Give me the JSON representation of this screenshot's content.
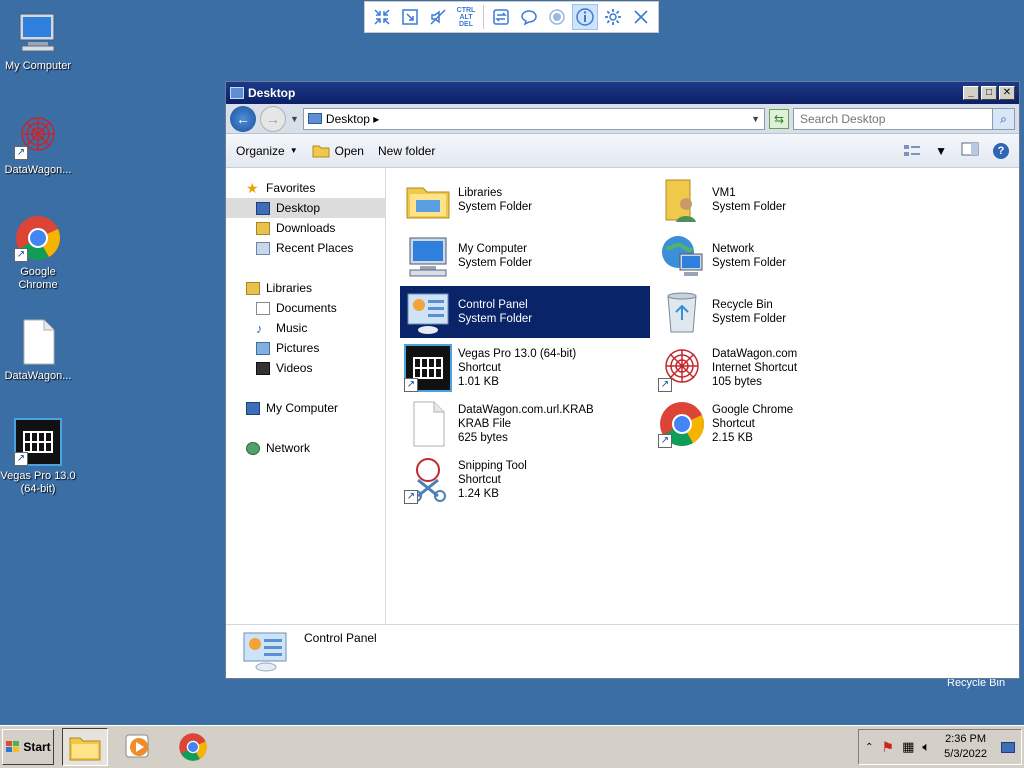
{
  "remote_toolbar": {
    "ctrl_alt_del": [
      "CTRL",
      "ALT",
      "DEL"
    ]
  },
  "desktop_icons": [
    {
      "label": "My Computer"
    },
    {
      "label": "DataWagon..."
    },
    {
      "label": "Google Chrome"
    },
    {
      "label": "DataWagon..."
    },
    {
      "label": "Vegas Pro 13.0 (64-bit)"
    }
  ],
  "desktop_caption": "Recycle Bin",
  "window": {
    "title": "Desktop",
    "address": "Desktop",
    "search_placeholder": "Search Desktop",
    "toolbar": {
      "organize": "Organize",
      "open": "Open",
      "new_folder": "New folder"
    },
    "nav": {
      "favorites": "Favorites",
      "desktop": "Desktop",
      "downloads": "Downloads",
      "recent_places": "Recent Places",
      "libraries": "Libraries",
      "documents": "Documents",
      "music": "Music",
      "pictures": "Pictures",
      "videos": "Videos",
      "my_computer": "My Computer",
      "network": "Network"
    },
    "items": [
      {
        "name": "Libraries",
        "type": "System Folder",
        "size": ""
      },
      {
        "name": "VM1",
        "type": "System Folder",
        "size": ""
      },
      {
        "name": "My Computer",
        "type": "System Folder",
        "size": ""
      },
      {
        "name": "Network",
        "type": "System Folder",
        "size": ""
      },
      {
        "name": "Control Panel",
        "type": "System Folder",
        "size": ""
      },
      {
        "name": "Recycle Bin",
        "type": "System Folder",
        "size": ""
      },
      {
        "name": "Vegas Pro 13.0 (64-bit)",
        "type": "Shortcut",
        "size": "1.01 KB"
      },
      {
        "name": "DataWagon.com",
        "type": "Internet Shortcut",
        "size": "105 bytes"
      },
      {
        "name": "DataWagon.com.url.KRAB",
        "type": "KRAB File",
        "size": "625 bytes"
      },
      {
        "name": "Google Chrome",
        "type": "Shortcut",
        "size": "2.15 KB"
      },
      {
        "name": "Snipping Tool",
        "type": "Shortcut",
        "size": "1.24 KB"
      }
    ],
    "details_name": "Control Panel"
  },
  "taskbar": {
    "start_label": "Start",
    "time": "2:36 PM",
    "date": "5/3/2022"
  }
}
